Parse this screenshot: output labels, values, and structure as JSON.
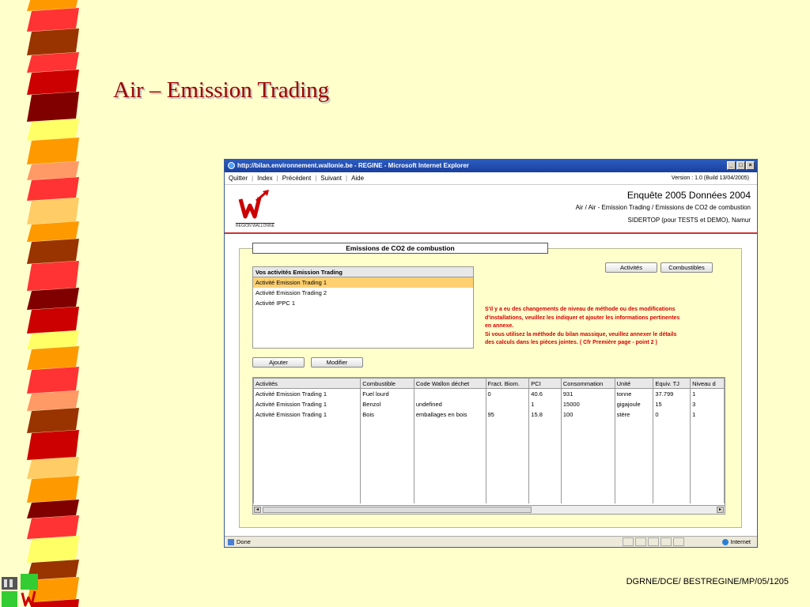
{
  "slide": {
    "title": "Air – Emission Trading",
    "footer": "DGRNE/DCE/ BESTREGINE/MP/05/1205"
  },
  "colors": {
    "stripe": [
      "#ff9900",
      "#ff3333",
      "#993300",
      "#cc0000",
      "#800000",
      "#ffff66",
      "#ff9966",
      "#ffcc66"
    ],
    "title": "#990000",
    "background": "#ffffcc"
  },
  "browser": {
    "title": "http://bilan.environnement.wallonie.be - REGINE - Microsoft Internet Explorer",
    "status": "Done",
    "zone": "Internet"
  },
  "menu": {
    "items": [
      "Quitter",
      "Index",
      "Précédent",
      "Suivant",
      "Aide"
    ],
    "version": "Version : 1.0 (Build 13/04/2005)"
  },
  "header": {
    "logo_text": "RÉGION WALLONNE",
    "title": "Enquête 2005 Données 2004",
    "path": "Air / Air - Emission Trading / Emissions de CO2 de combustion",
    "org": "SIDERTOP (pour TESTS et DEMO), Namur"
  },
  "panel": {
    "title": "Emissions de CO2 de combustion",
    "activities_header": "Vos activités Emission Trading",
    "activities": [
      "Activité Emission Trading 1",
      "Activité Emission Trading 2",
      "Activité IPPC 1"
    ],
    "btn_activites": "Activités",
    "btn_combustibles": "Combustibles",
    "btn_ajouter": "Ajouter",
    "btn_modifier": "Modifier",
    "warning_lines": [
      "S'il y a eu des changements de niveau de méthode ou des modifications",
      "d'installations, veuillez les indiquer et ajouter les informations pertinentes",
      "en annexe.",
      "Si vous utilisez la méthode du bilan massique, veuillez annexer le détails",
      "des calculs dans les pièces jointes. ( Cfr Première page - point 2 )"
    ]
  },
  "table": {
    "columns": [
      "Activités",
      "Combustible",
      "Code Wallon déchet",
      "Fract. Biom.",
      "PCI",
      "Consommation",
      "Unité",
      "Equiv. TJ",
      "Niveau d"
    ],
    "rows": [
      [
        "Activité Emission Trading 1",
        "Fuel lourd",
        "",
        "0",
        "40.6",
        "931",
        "tonne",
        "37.799",
        "1"
      ],
      [
        "Activité Emission Trading 1",
        "Benzol",
        "undefined",
        "",
        "1",
        "15000",
        "gigajoule",
        "15",
        "3"
      ],
      [
        "Activité Emission Trading 1",
        "Bois",
        "emballages en bois",
        "95",
        "15.8",
        "100",
        "stère",
        "0",
        "1"
      ]
    ]
  }
}
